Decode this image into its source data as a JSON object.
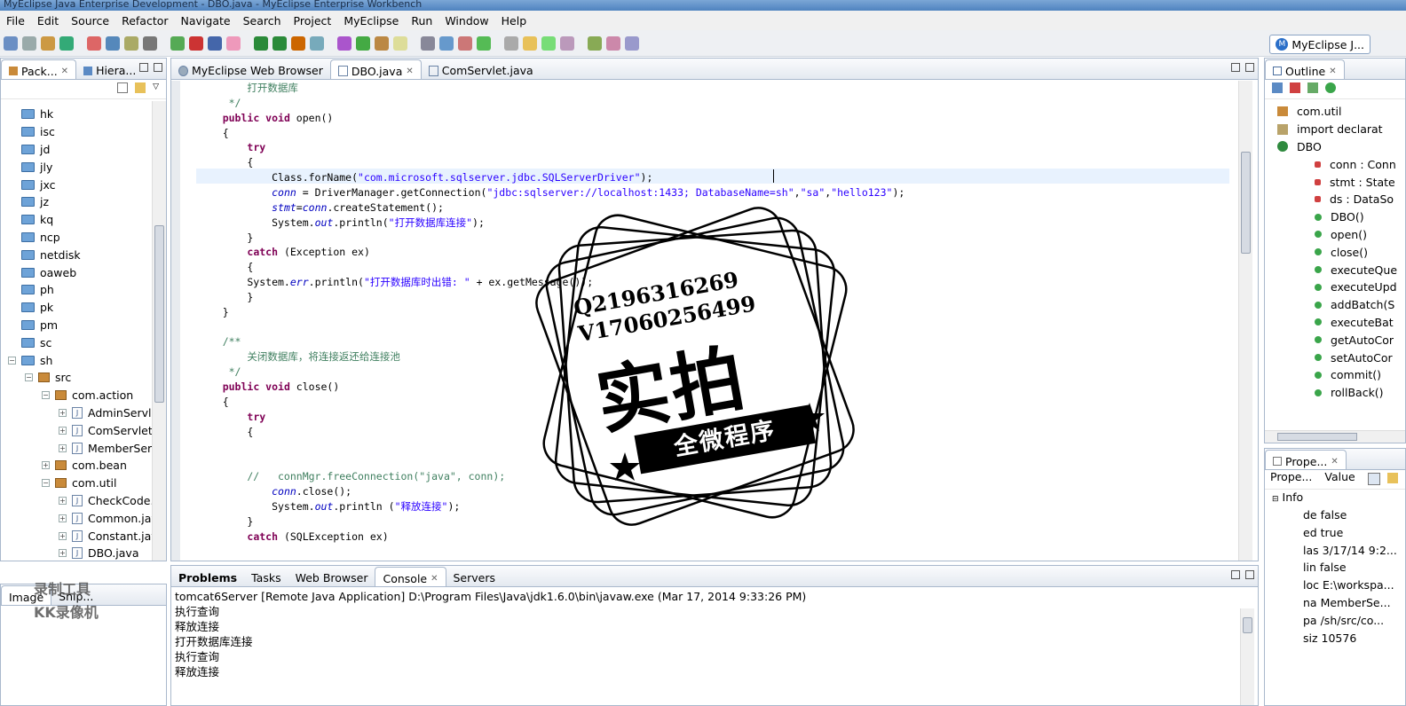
{
  "window_title": "MyEclipse Java Enterprise Development - DBO.java - MyEclipse Enterprise Workbench",
  "menu": [
    "File",
    "Edit",
    "Source",
    "Refactor",
    "Navigate",
    "Search",
    "Project",
    "MyEclipse",
    "Run",
    "Window",
    "Help"
  ],
  "perspective": {
    "label": "MyEclipse J..."
  },
  "left_panel": {
    "tabs": [
      "Pack...",
      "Hiera..."
    ]
  },
  "tree": [
    {
      "label": "hk",
      "kind": "folder",
      "indent": 0
    },
    {
      "label": "isc",
      "kind": "folder",
      "indent": 0
    },
    {
      "label": "jd",
      "kind": "folder",
      "indent": 0
    },
    {
      "label": "jly",
      "kind": "folder",
      "indent": 0
    },
    {
      "label": "jxc",
      "kind": "folder",
      "indent": 0
    },
    {
      "label": "jz",
      "kind": "folder",
      "indent": 0
    },
    {
      "label": "kq",
      "kind": "folder",
      "indent": 0
    },
    {
      "label": "ncp",
      "kind": "folder",
      "indent": 0
    },
    {
      "label": "netdisk",
      "kind": "folder",
      "indent": 0
    },
    {
      "label": "oaweb",
      "kind": "folder",
      "indent": 0
    },
    {
      "label": "ph",
      "kind": "folder",
      "indent": 0
    },
    {
      "label": "pk",
      "kind": "folder",
      "indent": 0
    },
    {
      "label": "pm",
      "kind": "folder",
      "indent": 0
    },
    {
      "label": "sc",
      "kind": "folder",
      "indent": 0
    },
    {
      "label": "sh",
      "kind": "folder",
      "indent": 0,
      "expanded": true
    },
    {
      "label": "src",
      "kind": "pkg",
      "indent": 1,
      "expanded": true
    },
    {
      "label": "com.action",
      "kind": "pkg",
      "indent": 2,
      "expanded": true
    },
    {
      "label": "AdminServle",
      "kind": "java",
      "indent": 3
    },
    {
      "label": "ComServlet.j",
      "kind": "java",
      "indent": 3
    },
    {
      "label": "MemberSer",
      "kind": "java",
      "indent": 3
    },
    {
      "label": "com.bean",
      "kind": "pkg",
      "indent": 2
    },
    {
      "label": "com.util",
      "kind": "pkg",
      "indent": 2,
      "expanded": true
    },
    {
      "label": "CheckCode.j",
      "kind": "java",
      "indent": 3
    },
    {
      "label": "Common.jav",
      "kind": "java",
      "indent": 3
    },
    {
      "label": "Constant.jav",
      "kind": "java",
      "indent": 3
    },
    {
      "label": "DBO.java",
      "kind": "java",
      "indent": 3
    }
  ],
  "image_panel": {
    "tab": "Image",
    "tab2": "Snip..."
  },
  "editor": {
    "tabs": [
      "MyEclipse Web Browser",
      "DBO.java",
      "ComServlet.java"
    ],
    "active_tab": 1
  },
  "code": [
    [
      {
        "t": "        打开数据库",
        "c": "cmt"
      }
    ],
    [
      {
        "t": "     */",
        "c": "cmt"
      }
    ],
    [
      {
        "t": "    "
      },
      {
        "t": "public void",
        "c": "kw"
      },
      {
        "t": " open()"
      }
    ],
    [
      {
        "t": "    {"
      }
    ],
    [
      {
        "t": "        "
      },
      {
        "t": "try",
        "c": "kw"
      }
    ],
    [
      {
        "t": "        {"
      }
    ],
    [
      {
        "t": "            Class.forName("
      },
      {
        "t": "\"com.microsoft.sqlserver.jdbc.SQLServerDriver\"",
        "c": "str"
      },
      {
        "t": ");"
      }
    ],
    [
      {
        "t": "            "
      },
      {
        "t": "conn",
        "c": "fld"
      },
      {
        "t": " = DriverManager.getConnection("
      },
      {
        "t": "\"jdbc:sqlserver://localhost:1433; DatabaseName=sh\"",
        "c": "str"
      },
      {
        "t": ","
      },
      {
        "t": "\"sa\"",
        "c": "str"
      },
      {
        "t": ","
      },
      {
        "t": "\"hello123\"",
        "c": "str"
      },
      {
        "t": ");"
      }
    ],
    [
      {
        "t": "            "
      },
      {
        "t": "stmt",
        "c": "fld"
      },
      {
        "t": "="
      },
      {
        "t": "conn",
        "c": "fld"
      },
      {
        "t": ".createStatement();"
      }
    ],
    [
      {
        "t": "            System."
      },
      {
        "t": "out",
        "c": "fld"
      },
      {
        "t": ".println("
      },
      {
        "t": "\"打开数据库连接\"",
        "c": "str"
      },
      {
        "t": ");"
      }
    ],
    [
      {
        "t": "        }"
      }
    ],
    [
      {
        "t": "        "
      },
      {
        "t": "catch",
        "c": "kw"
      },
      {
        "t": " (Exception ex)"
      }
    ],
    [
      {
        "t": "        {"
      }
    ],
    [
      {
        "t": "        System."
      },
      {
        "t": "err",
        "c": "fld"
      },
      {
        "t": ".println("
      },
      {
        "t": "\"打开数据库时出错: \"",
        "c": "str"
      },
      {
        "t": " + ex.getMessage());"
      }
    ],
    [
      {
        "t": "        }"
      }
    ],
    [
      {
        "t": "    }"
      }
    ],
    [
      {
        "t": ""
      }
    ],
    [
      {
        "t": "    /**",
        "c": "cmt"
      }
    ],
    [
      {
        "t": "        关闭数据库，将连接返还给连接池",
        "c": "cmt"
      }
    ],
    [
      {
        "t": "     */",
        "c": "cmt"
      }
    ],
    [
      {
        "t": "    "
      },
      {
        "t": "public void",
        "c": "kw"
      },
      {
        "t": " close()"
      }
    ],
    [
      {
        "t": "    {"
      }
    ],
    [
      {
        "t": "        "
      },
      {
        "t": "try",
        "c": "kw"
      }
    ],
    [
      {
        "t": "        {"
      }
    ],
    [
      {
        "t": ""
      }
    ],
    [
      {
        "t": ""
      }
    ],
    [
      {
        "t": "        //   connMgr.freeConnection(\"java\", conn);",
        "c": "cmt"
      }
    ],
    [
      {
        "t": "            "
      },
      {
        "t": "conn",
        "c": "fld"
      },
      {
        "t": ".close();"
      }
    ],
    [
      {
        "t": "            System."
      },
      {
        "t": "out",
        "c": "fld"
      },
      {
        "t": ".println ("
      },
      {
        "t": "\"释放连接\"",
        "c": "str"
      },
      {
        "t": ");"
      }
    ],
    [
      {
        "t": "        }"
      }
    ],
    [
      {
        "t": "        "
      },
      {
        "t": "catch",
        "c": "kw"
      },
      {
        "t": " (SQLException ex)"
      }
    ]
  ],
  "bottom_panel": {
    "tabs": [
      "Problems",
      "Tasks",
      "Web Browser",
      "Console",
      "Servers"
    ],
    "active_tab": 3,
    "header": "tomcat6Server [Remote Java Application] D:\\Program Files\\Java\\jdk1.6.0\\bin\\javaw.exe (Mar 17, 2014 9:33:26 PM)",
    "lines": [
      "执行查询",
      "释放连接",
      "打开数据库连接",
      "执行查询",
      "释放连接"
    ]
  },
  "outline": {
    "tab": "Outline",
    "items": [
      {
        "label": "com.util",
        "kind": "pkg",
        "indent": 0
      },
      {
        "label": "import declarat",
        "kind": "import",
        "indent": 0
      },
      {
        "label": "DBO",
        "kind": "class",
        "indent": 0
      },
      {
        "label": "conn : Conn",
        "kind": "field",
        "indent": 1
      },
      {
        "label": "stmt : State",
        "kind": "field",
        "indent": 1
      },
      {
        "label": "ds : DataSo",
        "kind": "field",
        "indent": 1
      },
      {
        "label": "DBO()",
        "kind": "method",
        "indent": 1
      },
      {
        "label": "open()",
        "kind": "method",
        "indent": 1
      },
      {
        "label": "close()",
        "kind": "method",
        "indent": 1
      },
      {
        "label": "executeQue",
        "kind": "method",
        "indent": 1
      },
      {
        "label": "executeUpd",
        "kind": "method",
        "indent": 1
      },
      {
        "label": "addBatch(S",
        "kind": "method",
        "indent": 1
      },
      {
        "label": "executeBat",
        "kind": "method",
        "indent": 1
      },
      {
        "label": "getAutoCor",
        "kind": "method",
        "indent": 1
      },
      {
        "label": "setAutoCor",
        "kind": "method",
        "indent": 1
      },
      {
        "label": "commit()",
        "kind": "method",
        "indent": 1
      },
      {
        "label": "rollBack()",
        "kind": "method",
        "indent": 1
      }
    ]
  },
  "properties": {
    "tab": "Prope...",
    "col_property": "Prope...",
    "col_value": "Value",
    "group": "Info",
    "rows": [
      {
        "k": "de",
        "v": "false"
      },
      {
        "k": "ed",
        "v": "true"
      },
      {
        "k": "las",
        "v": "3/17/14 9:2..."
      },
      {
        "k": "lin",
        "v": "false"
      },
      {
        "k": "loc",
        "v": "E:\\workspa..."
      },
      {
        "k": "na",
        "v": "MemberSe..."
      },
      {
        "k": "pa",
        "v": "/sh/src/co..."
      },
      {
        "k": "siz",
        "v": "10576"
      }
    ]
  },
  "watermark": {
    "qq": "Q2196316269",
    "phone": "V17060256499",
    "big": "实拍",
    "band": "全微程序"
  },
  "overlay_logo": [
    "录制工具",
    "KK录像机"
  ]
}
